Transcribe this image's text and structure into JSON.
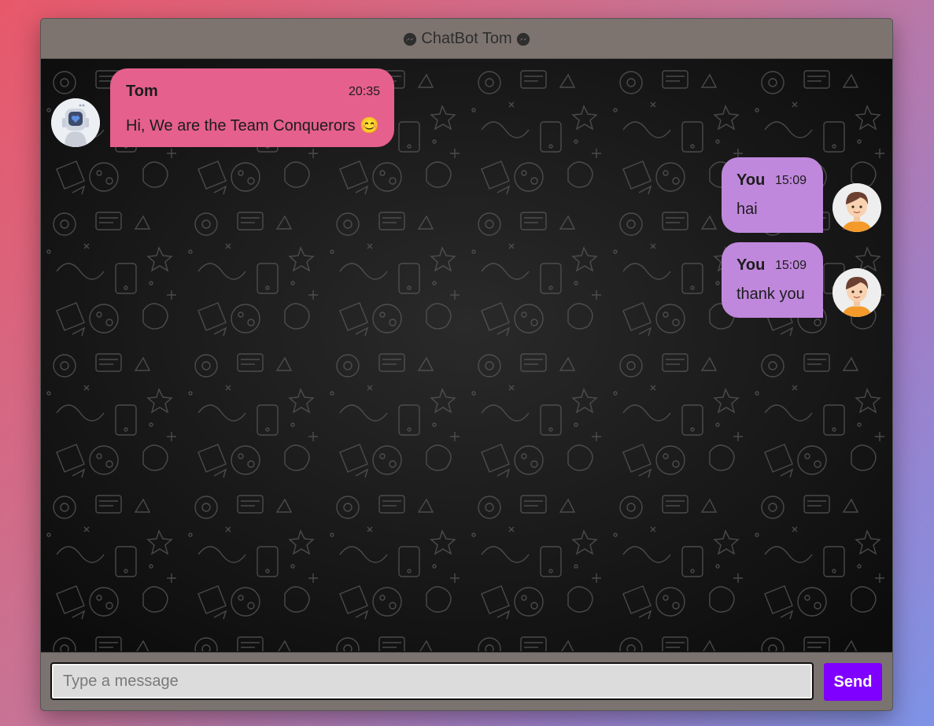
{
  "header": {
    "title": "ChatBot Tom",
    "icon": "messenger-icon"
  },
  "messages": [
    {
      "sender": "Tom",
      "time": "20:35",
      "text": "Hi, We are the Team Conquerors",
      "emoji": "😊",
      "avatar": "robot-avatar",
      "side": "left"
    },
    {
      "sender": "You",
      "time": "15:09",
      "text": "hai",
      "avatar": "boy-avatar",
      "side": "right"
    },
    {
      "sender": "You",
      "time": "15:09",
      "text": "thank you",
      "avatar": "boy-avatar",
      "side": "right"
    }
  ],
  "composer": {
    "placeholder": "Type a message",
    "value": "",
    "send_label": "Send"
  },
  "colors": {
    "bot_bubble": "#e5608c",
    "user_bubble": "#c088dc",
    "send_button": "#7f00ff",
    "header": "#7d7470"
  }
}
